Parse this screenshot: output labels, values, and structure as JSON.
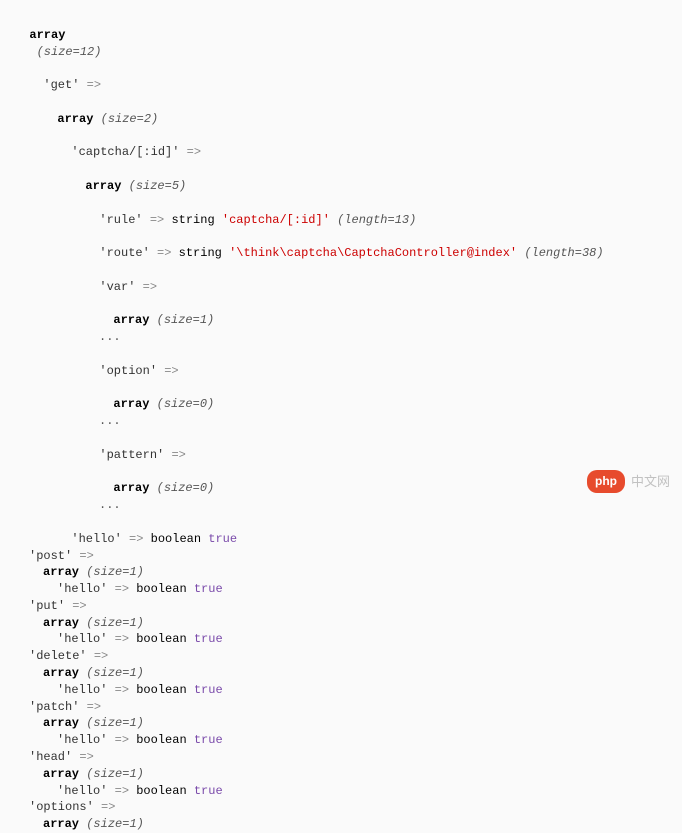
{
  "root": {
    "size": 12
  },
  "get": {
    "key": "get",
    "size": 2,
    "captcha": {
      "key": "captcha/[:id]",
      "size": 5,
      "rule": {
        "key": "rule",
        "type": "string",
        "value": "captcha/[:id]",
        "length": 13
      },
      "route": {
        "key": "route",
        "type": "string",
        "value": "\\think\\captcha\\CaptchaController@index",
        "length": 38
      },
      "var": {
        "key": "var",
        "size": 1
      },
      "option": {
        "key": "option",
        "size": 0
      },
      "pattern": {
        "key": "pattern",
        "size": 0
      }
    },
    "hello": {
      "key": "hello",
      "type": "boolean",
      "value": "true"
    }
  },
  "post": {
    "key": "post",
    "size": 1,
    "hello": {
      "key": "hello",
      "type": "boolean",
      "value": "true"
    }
  },
  "put": {
    "key": "put",
    "size": 1,
    "hello": {
      "key": "hello",
      "type": "boolean",
      "value": "true"
    }
  },
  "delete": {
    "key": "delete",
    "size": 1,
    "hello": {
      "key": "hello",
      "type": "boolean",
      "value": "true"
    }
  },
  "patch": {
    "key": "patch",
    "size": 1,
    "hello": {
      "key": "hello",
      "type": "boolean",
      "value": "true"
    }
  },
  "head": {
    "key": "head",
    "size": 1,
    "hello": {
      "key": "hello",
      "type": "boolean",
      "value": "true"
    }
  },
  "options": {
    "key": "options",
    "size": 1
  },
  "ui": {
    "kw_array": "array",
    "size_prefix": "(size=",
    "size_suffix": ")",
    "arrow": "=>",
    "len_prefix": "(length=",
    "len_suffix": ")",
    "dots": "..."
  },
  "watermark": {
    "badge": "php",
    "text": "中文网"
  }
}
